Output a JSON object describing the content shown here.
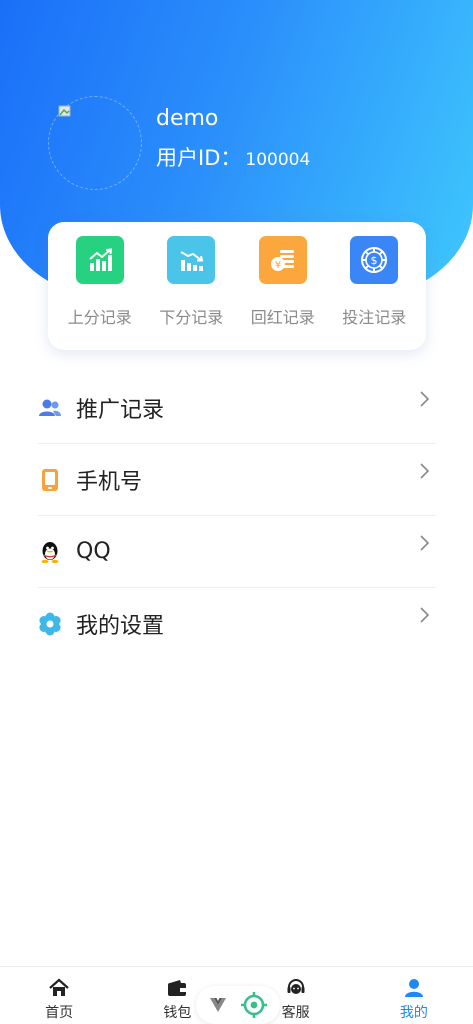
{
  "profile": {
    "username": "demo",
    "uid_label": "用户ID：",
    "uid_value": "100004",
    "avatar_icon": "broken-image-icon"
  },
  "records": [
    {
      "label": "上分记录",
      "icon": "chart-up-icon",
      "color": "#26d27f"
    },
    {
      "label": "下分记录",
      "icon": "chart-down-icon",
      "color": "#4bc4ea"
    },
    {
      "label": "回红记录",
      "icon": "coins-icon",
      "color": "#fba73d"
    },
    {
      "label": "投注记录",
      "icon": "dollar-chip-icon",
      "color": "#3b86f7"
    }
  ],
  "menu": [
    {
      "label": "推广记录",
      "icon": "users-icon"
    },
    {
      "label": "手机号",
      "icon": "phone-icon"
    },
    {
      "label": "QQ",
      "icon": "qq-penguin-icon"
    },
    {
      "label": "我的设置",
      "icon": "settings-flower-icon"
    }
  ],
  "tabs": [
    {
      "label": "首页",
      "icon": "home-icon"
    },
    {
      "label": "钱包",
      "icon": "wallet-icon"
    },
    {
      "label": "客服",
      "icon": "headset-icon"
    },
    {
      "label": "我的",
      "icon": "user-icon",
      "active": true
    }
  ],
  "floating": {
    "icons": [
      "vue-logo-icon",
      "target-icon"
    ]
  },
  "colors": {
    "accent": "#1e88f5",
    "header_start": "#1a6ff8",
    "header_end": "#3fc8fd"
  }
}
